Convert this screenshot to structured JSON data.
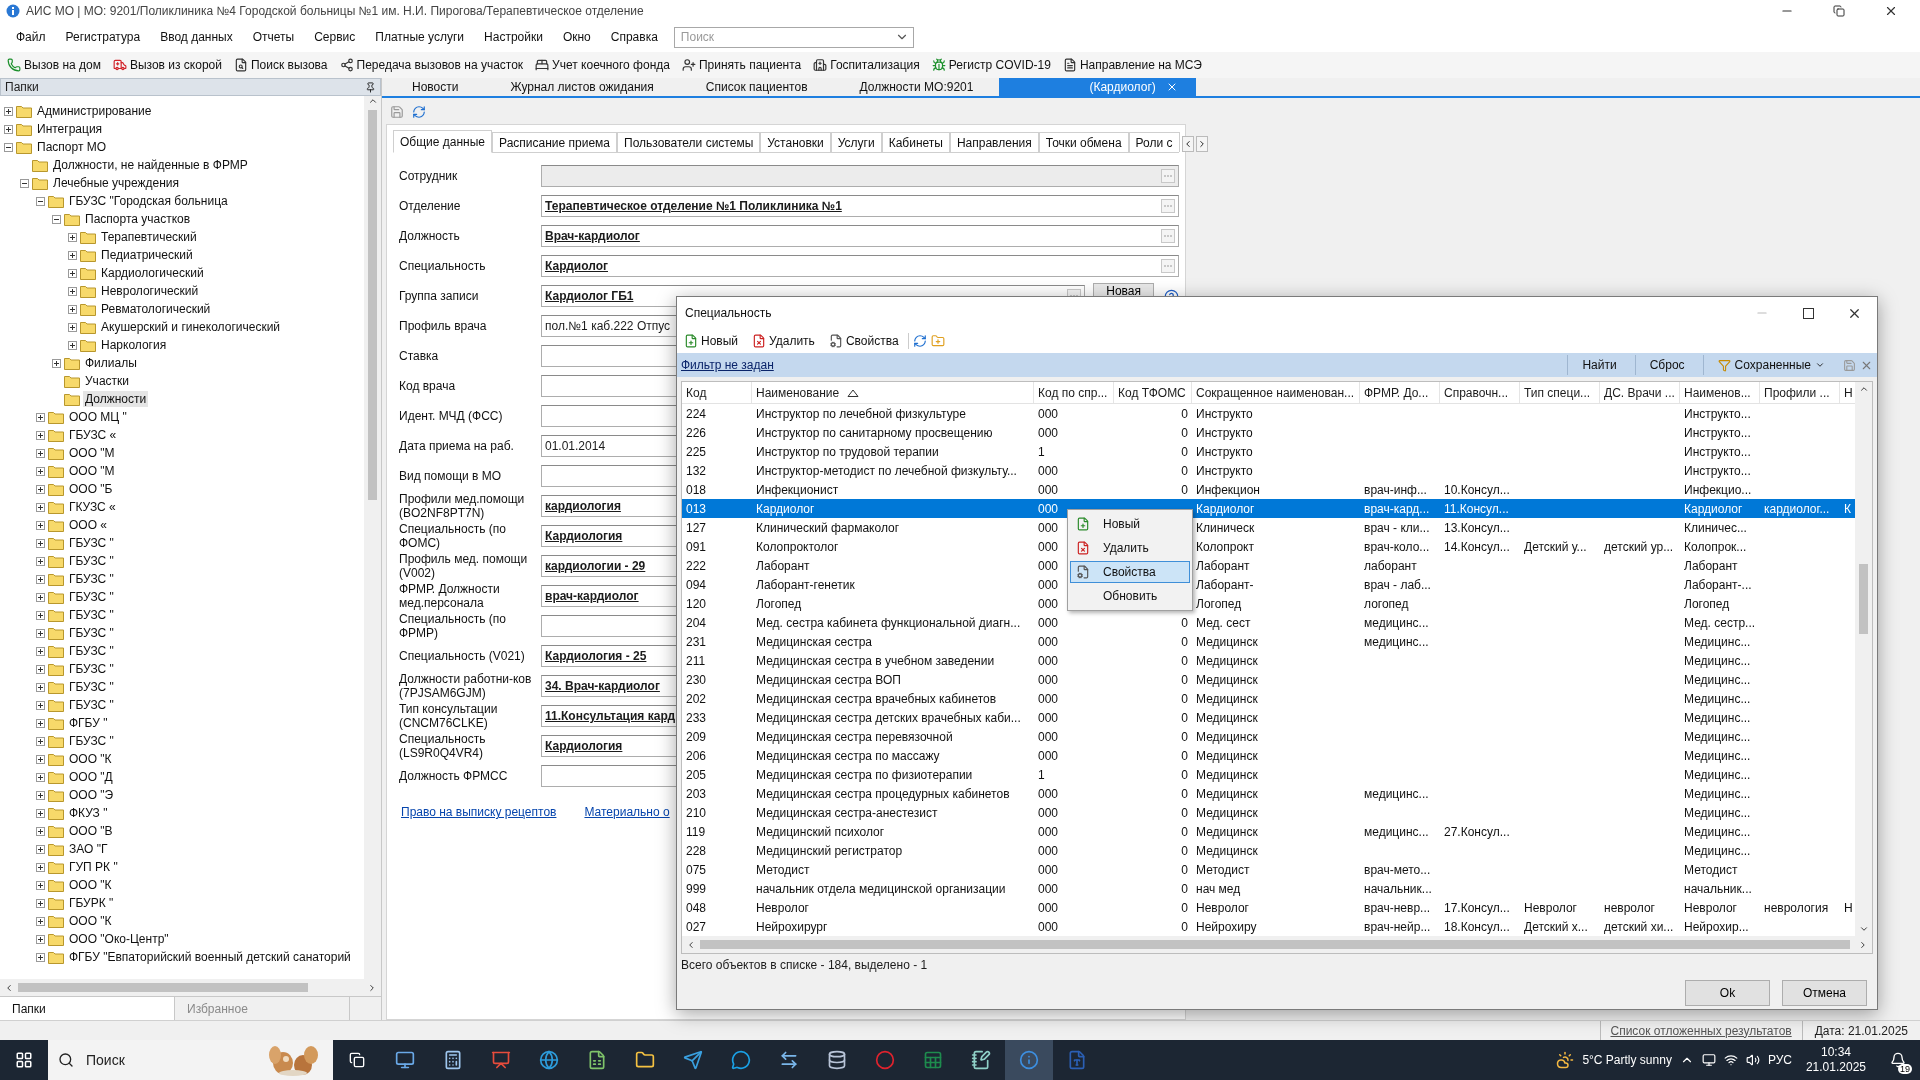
{
  "window": {
    "title": "АИС МО | МО: 9201/Поликлиника №4 Городской больницы №1 им. Н.И. Пирогова/Терапевтическое отделение"
  },
  "menu": [
    "Файл",
    "Регистратура",
    "Ввод данных",
    "Отчеты",
    "Сервис",
    "Платные услуги",
    "Настройки",
    "Окно",
    "Справка"
  ],
  "menu_search": {
    "placeholder": "Поиск"
  },
  "toolbar": [
    "Вызов на дом",
    "Вызов из скорой",
    "Поиск вызова",
    "Передача вызовов на участок",
    "Учет коечного фонда",
    "Принять пациента",
    "Госпитализация",
    "Регистр COVID-19",
    "Направление на МСЭ"
  ],
  "folders_panel": {
    "title": "Папки",
    "tree": [
      {
        "label": "Администрирование",
        "has_children": true,
        "expanded": false,
        "selected": false
      },
      {
        "label": "Интеграция",
        "has_children": true,
        "expanded": false,
        "selected": false
      },
      {
        "label": "Паспорт МО",
        "has_children": true,
        "expanded": true,
        "selected": false,
        "children": [
          {
            "label": "Должности, не найденные в ФРМР",
            "has_children": false,
            "expanded": false,
            "selected": false
          },
          {
            "label": "Лечебные учреждения",
            "has_children": true,
            "expanded": true,
            "selected": false,
            "children": [
              {
                "label": "ГБУЗС \"Городская больница",
                "has_children": true,
                "expanded": true,
                "selected": false,
                "children": [
                  {
                    "label": "Паспорта участков",
                    "has_children": true,
                    "expanded": true,
                    "selected": false,
                    "children": [
                      {
                        "label": "Терапевтический",
                        "has_children": true,
                        "expanded": false,
                        "selected": false
                      },
                      {
                        "label": "Педиатрический",
                        "has_children": true,
                        "expanded": false,
                        "selected": false
                      },
                      {
                        "label": "Кардиологический",
                        "has_children": true,
                        "expanded": false,
                        "selected": false
                      },
                      {
                        "label": "Неврологический",
                        "has_children": true,
                        "expanded": false,
                        "selected": false
                      },
                      {
                        "label": "Ревматологический",
                        "has_children": true,
                        "expanded": false,
                        "selected": false
                      },
                      {
                        "label": "Акушерский и гинекологический",
                        "has_children": true,
                        "expanded": false,
                        "selected": false
                      },
                      {
                        "label": "Наркология",
                        "has_children": true,
                        "expanded": false,
                        "selected": false
                      }
                    ]
                  },
                  {
                    "label": "Филиалы",
                    "has_children": true,
                    "expanded": false,
                    "selected": false
                  },
                  {
                    "label": "Участки",
                    "has_children": false,
                    "expanded": false,
                    "selected": false
                  },
                  {
                    "label": "Должности",
                    "has_children": false,
                    "expanded": false,
                    "selected": true
                  }
                ]
              },
              {
                "label": "ООО МЦ \"",
                "has_children": true,
                "expanded": false,
                "selected": false
              },
              {
                "label": "ГБУЗС «",
                "has_children": true,
                "expanded": false,
                "selected": false
              },
              {
                "label": "ООО \"М",
                "has_children": true,
                "expanded": false,
                "selected": false
              },
              {
                "label": "ООО \"М",
                "has_children": true,
                "expanded": false,
                "selected": false
              },
              {
                "label": "ООО \"Б",
                "has_children": true,
                "expanded": false,
                "selected": false
              },
              {
                "label": "ГКУЗС «",
                "has_children": true,
                "expanded": false,
                "selected": false
              },
              {
                "label": "ООО «",
                "has_children": true,
                "expanded": false,
                "selected": false
              },
              {
                "label": "ГБУЗС \"",
                "has_children": true,
                "expanded": false,
                "selected": false
              },
              {
                "label": "ГБУЗС \"",
                "has_children": true,
                "expanded": false,
                "selected": false
              },
              {
                "label": "ГБУЗС \"",
                "has_children": true,
                "expanded": false,
                "selected": false
              },
              {
                "label": "ГБУЗС \"",
                "has_children": true,
                "expanded": false,
                "selected": false
              },
              {
                "label": "ГБУЗС \"",
                "has_children": true,
                "expanded": false,
                "selected": false
              },
              {
                "label": "ГБУЗС \"",
                "has_children": true,
                "expanded": false,
                "selected": false
              },
              {
                "label": "ГБУЗС \"",
                "has_children": true,
                "expanded": false,
                "selected": false
              },
              {
                "label": "ГБУЗС \"",
                "has_children": true,
                "expanded": false,
                "selected": false
              },
              {
                "label": "ГБУЗС \"",
                "has_children": true,
                "expanded": false,
                "selected": false
              },
              {
                "label": "ГБУЗС \"",
                "has_children": true,
                "expanded": false,
                "selected": false
              },
              {
                "label": "ФГБУ \"",
                "has_children": true,
                "expanded": false,
                "selected": false
              },
              {
                "label": "ГБУЗС \"",
                "has_children": true,
                "expanded": false,
                "selected": false
              },
              {
                "label": "ООО \"К",
                "has_children": true,
                "expanded": false,
                "selected": false
              },
              {
                "label": "ООО \"Д",
                "has_children": true,
                "expanded": false,
                "selected": false
              },
              {
                "label": "ООО \"Э",
                "has_children": true,
                "expanded": false,
                "selected": false
              },
              {
                "label": "ФКУЗ \"",
                "has_children": true,
                "expanded": false,
                "selected": false
              },
              {
                "label": "ООО \"В",
                "has_children": true,
                "expanded": false,
                "selected": false
              },
              {
                "label": "ЗАО \"Г",
                "has_children": true,
                "expanded": false,
                "selected": false
              },
              {
                "label": "ГУП РК \"",
                "has_children": true,
                "expanded": false,
                "selected": false
              },
              {
                "label": "ООО \"К",
                "has_children": true,
                "expanded": false,
                "selected": false
              },
              {
                "label": "ГБУРК \"",
                "has_children": true,
                "expanded": false,
                "selected": false
              },
              {
                "label": "ООО \"К",
                "has_children": true,
                "expanded": false,
                "selected": false
              },
              {
                "label": "ООО \"Око-Центр\"",
                "has_children": true,
                "expanded": false,
                "selected": false
              },
              {
                "label": "ФГБУ \"Евпаторийский военный детский санаторий",
                "has_children": true,
                "expanded": false,
                "selected": false
              }
            ]
          }
        ]
      }
    ],
    "bottom_tabs": [
      {
        "label": "Папки",
        "selected": true
      },
      {
        "label": "Избранное",
        "selected": false
      }
    ]
  },
  "main_tabs": [
    {
      "label": "Новости",
      "selected": false,
      "closable": false
    },
    {
      "label": "Журнал листов ожидания",
      "selected": false,
      "closable": false
    },
    {
      "label": "Список пациентов",
      "selected": false,
      "closable": false
    },
    {
      "label": "Должности МО:9201",
      "selected": false,
      "closable": false
    },
    {
      "label": "(Кардиолог)",
      "selected": true,
      "closable": true
    }
  ],
  "form": {
    "tabs": [
      {
        "label": "Общие данные",
        "selected": true
      },
      {
        "label": "Расписание приема",
        "selected": false
      },
      {
        "label": "Пользователи системы",
        "selected": false
      },
      {
        "label": "Установки",
        "selected": false
      },
      {
        "label": "Услуги",
        "selected": false
      },
      {
        "label": "Кабинеты",
        "selected": false
      },
      {
        "label": "Направления",
        "selected": false
      },
      {
        "label": "Точки обмена",
        "selected": false
      },
      {
        "label": "Роли с",
        "selected": false
      }
    ],
    "fields": [
      {
        "label": "Сотрудник",
        "kind": "lookup",
        "disabled": true,
        "picker": true
      },
      {
        "label": "Отделение",
        "value": "Терапевтическое отделение №1 Поликлиника №1",
        "kind": "lookup",
        "disabled": false,
        "picker": true
      },
      {
        "label": "Должность",
        "value": "Врач-кардиолог",
        "kind": "lookup",
        "disabled": false,
        "picker": true
      },
      {
        "label": "Специальность",
        "value": "Кардиолог",
        "kind": "lookup",
        "disabled": false,
        "picker": true
      },
      {
        "label": "Группа записи",
        "value": "Кардиолог ГБ1",
        "kind": "lookup",
        "disabled": false,
        "picker": true,
        "button": "Новая"
      },
      {
        "label": "Профиль врача",
        "value": "пол.№1 каб.222  Отпус",
        "kind": "text",
        "disabled": false,
        "picker": false
      },
      {
        "label": "Ставка",
        "kind": "text",
        "disabled": false,
        "picker": false
      },
      {
        "label": "Код врача",
        "kind": "text",
        "disabled": false,
        "picker": false
      },
      {
        "label": "Идент. МЧД (ФСС)",
        "kind": "text",
        "disabled": false,
        "picker": false
      },
      {
        "label": "Дата приема на раб.",
        "value": "01.01.2014",
        "kind": "text",
        "disabled": false,
        "picker": false
      },
      {
        "label": "Вид помощи в МО",
        "kind": "text",
        "disabled": false,
        "picker": false
      },
      {
        "label": "Профили мед.помощи (BO2NF8PT7N)",
        "value": "кардиология",
        "kind": "lookup",
        "disabled": false,
        "picker": false
      },
      {
        "label": "Специальность (по ФОМС)",
        "value": "Кардиология",
        "kind": "lookup",
        "disabled": false,
        "picker": false
      },
      {
        "label": "Профиль мед. помощи (V002)",
        "value": "кардиологии - 29",
        "kind": "lookup",
        "disabled": false,
        "picker": false
      },
      {
        "label": "ФРМР. Должности мед.персонала",
        "value": "врач-кардиолог",
        "kind": "lookup",
        "disabled": false,
        "picker": false
      },
      {
        "label": "Специальность (по ФРМР)",
        "kind": "lookup",
        "disabled": false,
        "picker": false
      },
      {
        "label": "Специальность (V021)",
        "value": "Кардиология - 25",
        "kind": "lookup",
        "disabled": false,
        "picker": false
      },
      {
        "label": "Должности работни-ков (7PJSAM6GJM)",
        "value": "34. Врач-кардиолог",
        "kind": "lookup",
        "disabled": false,
        "picker": false
      },
      {
        "label": "Тип консультации (CNCM76CLKE)",
        "value": "11.Консультация кард",
        "kind": "lookup",
        "disabled": false,
        "picker": false
      },
      {
        "label": "Специальность (LS9R0Q4VR4)",
        "value": "Кардиология",
        "kind": "lookup",
        "disabled": false,
        "picker": false
      },
      {
        "label": "Должность ФРМСС",
        "kind": "text",
        "disabled": false,
        "picker": false
      }
    ],
    "links": [
      "Право на выписку рецептов",
      "Материально о"
    ]
  },
  "dialog": {
    "title": "Специальность",
    "toolbar": [
      "Новый",
      "Удалить",
      "Свойства"
    ],
    "filter": "Фильтр не задан",
    "find": "Найти",
    "reset": "Сброс",
    "saved": "Сохраненные",
    "columns": [
      {
        "label": "Код"
      },
      {
        "label": "Наименование",
        "sorted": true
      },
      {
        "label": "Код по спр..."
      },
      {
        "label": "Код ТФОМС"
      },
      {
        "label": "Сокращенное наименован..."
      },
      {
        "label": "ФРМР. До..."
      },
      {
        "label": "Справочн..."
      },
      {
        "label": "Тип специ..."
      },
      {
        "label": "ДС. Врачи ..."
      },
      {
        "label": "Наименов..."
      },
      {
        "label": "Профили ..."
      },
      {
        "label": "Н"
      }
    ],
    "rows": [
      {
        "selected": false,
        "code": "224",
        "name": "Инструктор по лечебной физкультуре",
        "code_spr": "000",
        "tfoms": "0",
        "short": "Инструкто",
        "naimen": "Инструкто..."
      },
      {
        "selected": false,
        "code": "226",
        "name": "Инструктор по санитарному просвещению",
        "code_spr": "000",
        "tfoms": "0",
        "short": "Инструкто",
        "naimen": "Инструкто..."
      },
      {
        "selected": false,
        "code": "225",
        "name": "Инструктор по трудовой терапии",
        "code_spr": "1",
        "tfoms": "0",
        "short": "Инструкто",
        "naimen": "Инструкто..."
      },
      {
        "selected": false,
        "code": "132",
        "name": "Инструктор-методист по лечебной физкульту...",
        "code_spr": "000",
        "tfoms": "0",
        "short": "Инструкто",
        "naimen": "Инструкто..."
      },
      {
        "selected": false,
        "code": "018",
        "name": "Инфекционист",
        "code_spr": "000",
        "tfoms": "0",
        "short": "Инфекцион",
        "frmr": "врач-инф...",
        "sprav": "10.Консул...",
        "naimen": "Инфекцио..."
      },
      {
        "selected": true,
        "code": "013",
        "name": "Кардиолог",
        "code_spr": "000",
        "short": "Кардиолог",
        "frmr": "врач-кард...",
        "sprav": "11.Консул...",
        "naimen": "Кардиолог",
        "profili": "кардиолог...",
        "n": "К"
      },
      {
        "selected": false,
        "code": "127",
        "name": "Клинический фармаколог",
        "code_spr": "000",
        "short": "Клиническ",
        "frmr": "врач - кли...",
        "sprav": "13.Консул...",
        "naimen": "Клиничес..."
      },
      {
        "selected": false,
        "code": "091",
        "name": "Колопроктолог",
        "code_spr": "000",
        "short": "Колопрокт",
        "frmr": "врач-коло...",
        "sprav": "14.Консул...",
        "tip": "Детский у...",
        "ds": "детский ур...",
        "naimen": "Колопрок..."
      },
      {
        "selected": false,
        "code": "222",
        "name": "Лаборант",
        "code_spr": "000",
        "short": "Лаборант",
        "frmr": "лаборант",
        "naimen": "Лаборант"
      },
      {
        "selected": false,
        "code": "094",
        "name": "Лаборант-генетик",
        "code_spr": "000",
        "short": "Лаборант-",
        "frmr": "врач - лаб...",
        "naimen": "Лаборант-..."
      },
      {
        "selected": false,
        "code": "120",
        "name": "Логопед",
        "code_spr": "000",
        "short": "Логопед",
        "frmr": "логопед",
        "naimen": "Логопед"
      },
      {
        "selected": false,
        "code": "204",
        "name": "Мед. сестра кабинета функциональной диагн...",
        "code_spr": "000",
        "tfoms": "0",
        "short": "Мед. сест",
        "frmr": "медицинс...",
        "naimen": "Мед. сестр..."
      },
      {
        "selected": false,
        "code": "231",
        "name": "Медицинская сестра",
        "code_spr": "000",
        "tfoms": "0",
        "short": "Медицинск",
        "frmr": "медицинс...",
        "naimen": "Медицинс..."
      },
      {
        "selected": false,
        "code": "211",
        "name": "Медицинская сестра в учебном заведении",
        "code_spr": "000",
        "tfoms": "0",
        "short": "Медицинск",
        "naimen": "Медицинс..."
      },
      {
        "selected": false,
        "code": "230",
        "name": "Медицинская сестра ВОП",
        "code_spr": "000",
        "tfoms": "0",
        "short": "Медицинск",
        "naimen": "Медицинс..."
      },
      {
        "selected": false,
        "code": "202",
        "name": "Медицинская сестра врачебных кабинетов",
        "code_spr": "000",
        "tfoms": "0",
        "short": "Медицинск",
        "naimen": "Медицинс..."
      },
      {
        "selected": false,
        "code": "233",
        "name": "Медицинская сестра детских врачебных каби...",
        "code_spr": "000",
        "tfoms": "0",
        "short": "Медицинск",
        "naimen": "Медицинс..."
      },
      {
        "selected": false,
        "code": "209",
        "name": "Медицинская сестра перевязочной",
        "code_spr": "000",
        "tfoms": "0",
        "short": "Медицинск",
        "naimen": "Медицинс..."
      },
      {
        "selected": false,
        "code": "206",
        "name": "Медицинская сестра по массажу",
        "code_spr": "000",
        "tfoms": "0",
        "short": "Медицинск",
        "naimen": "Медицинс..."
      },
      {
        "selected": false,
        "code": "205",
        "name": "Медицинская сестра по физиотерапии",
        "code_spr": "1",
        "tfoms": "0",
        "short": "Медицинск",
        "naimen": "Медицинс..."
      },
      {
        "selected": false,
        "code": "203",
        "name": "Медицинская сестра процедурных кабинетов",
        "code_spr": "000",
        "tfoms": "0",
        "short": "Медицинск",
        "frmr": "медицинс...",
        "naimen": "Медицинс..."
      },
      {
        "selected": false,
        "code": "210",
        "name": "Медицинская сестра-анестезист",
        "code_spr": "000",
        "tfoms": "0",
        "short": "Медицинск",
        "naimen": "Медицинс..."
      },
      {
        "selected": false,
        "code": "119",
        "name": "Медицинский психолог",
        "code_spr": "000",
        "tfoms": "0",
        "short": "Медицинск",
        "frmr": "медицинс...",
        "sprav": "27.Консул...",
        "naimen": "Медицинс..."
      },
      {
        "selected": false,
        "code": "228",
        "name": "Медицинский регистратор",
        "code_spr": "000",
        "tfoms": "0",
        "short": "Медицинск",
        "naimen": "Медицинс..."
      },
      {
        "selected": false,
        "code": "075",
        "name": "Методист",
        "code_spr": "000",
        "tfoms": "0",
        "short": "Методист",
        "frmr": "врач-мето...",
        "naimen": "Методист"
      },
      {
        "selected": false,
        "code": "999",
        "name": "начальник отдела медицинской организации",
        "code_spr": "000",
        "tfoms": "0",
        "short": "нач мед",
        "frmr": "начальник...",
        "naimen": "начальник..."
      },
      {
        "selected": false,
        "code": "048",
        "name": "Невролог",
        "code_spr": "000",
        "tfoms": "0",
        "short": "Невролог",
        "frmr": "врач-невр...",
        "sprav": "17.Консул...",
        "tip": "Невролог",
        "ds": "невролог",
        "naimen": "Невролог",
        "profili": "неврология",
        "n": "Н"
      },
      {
        "selected": false,
        "code": "027",
        "name": "Нейрохирург",
        "code_spr": "000",
        "tfoms": "0",
        "short": "Нейрохиру",
        "frmr": "врач-нейр...",
        "sprav": "18.Консул...",
        "tip": "Детский х...",
        "ds": "детский хи...",
        "naimen": "Нейрохир..."
      }
    ],
    "context_menu": [
      {
        "label": "Новый",
        "selected": false
      },
      {
        "label": "Удалить",
        "selected": false
      },
      {
        "label": "Свойства",
        "selected": true
      },
      {
        "label": "Обновить",
        "selected": false
      }
    ],
    "summary": "Всего объектов в списке - 184, выделено - 1",
    "buttons": [
      "Ok",
      "Отмена"
    ]
  },
  "status_bar": {
    "link": "Список отложенных результатов",
    "date": "Дата: 21.01.2025"
  },
  "taskbar": {
    "search": {
      "placeholder": "Поиск"
    },
    "weather": "5°C  Partly sunny",
    "language": "РУС",
    "time": "10:34",
    "date": "21.01.2025",
    "notifications": "19"
  }
}
